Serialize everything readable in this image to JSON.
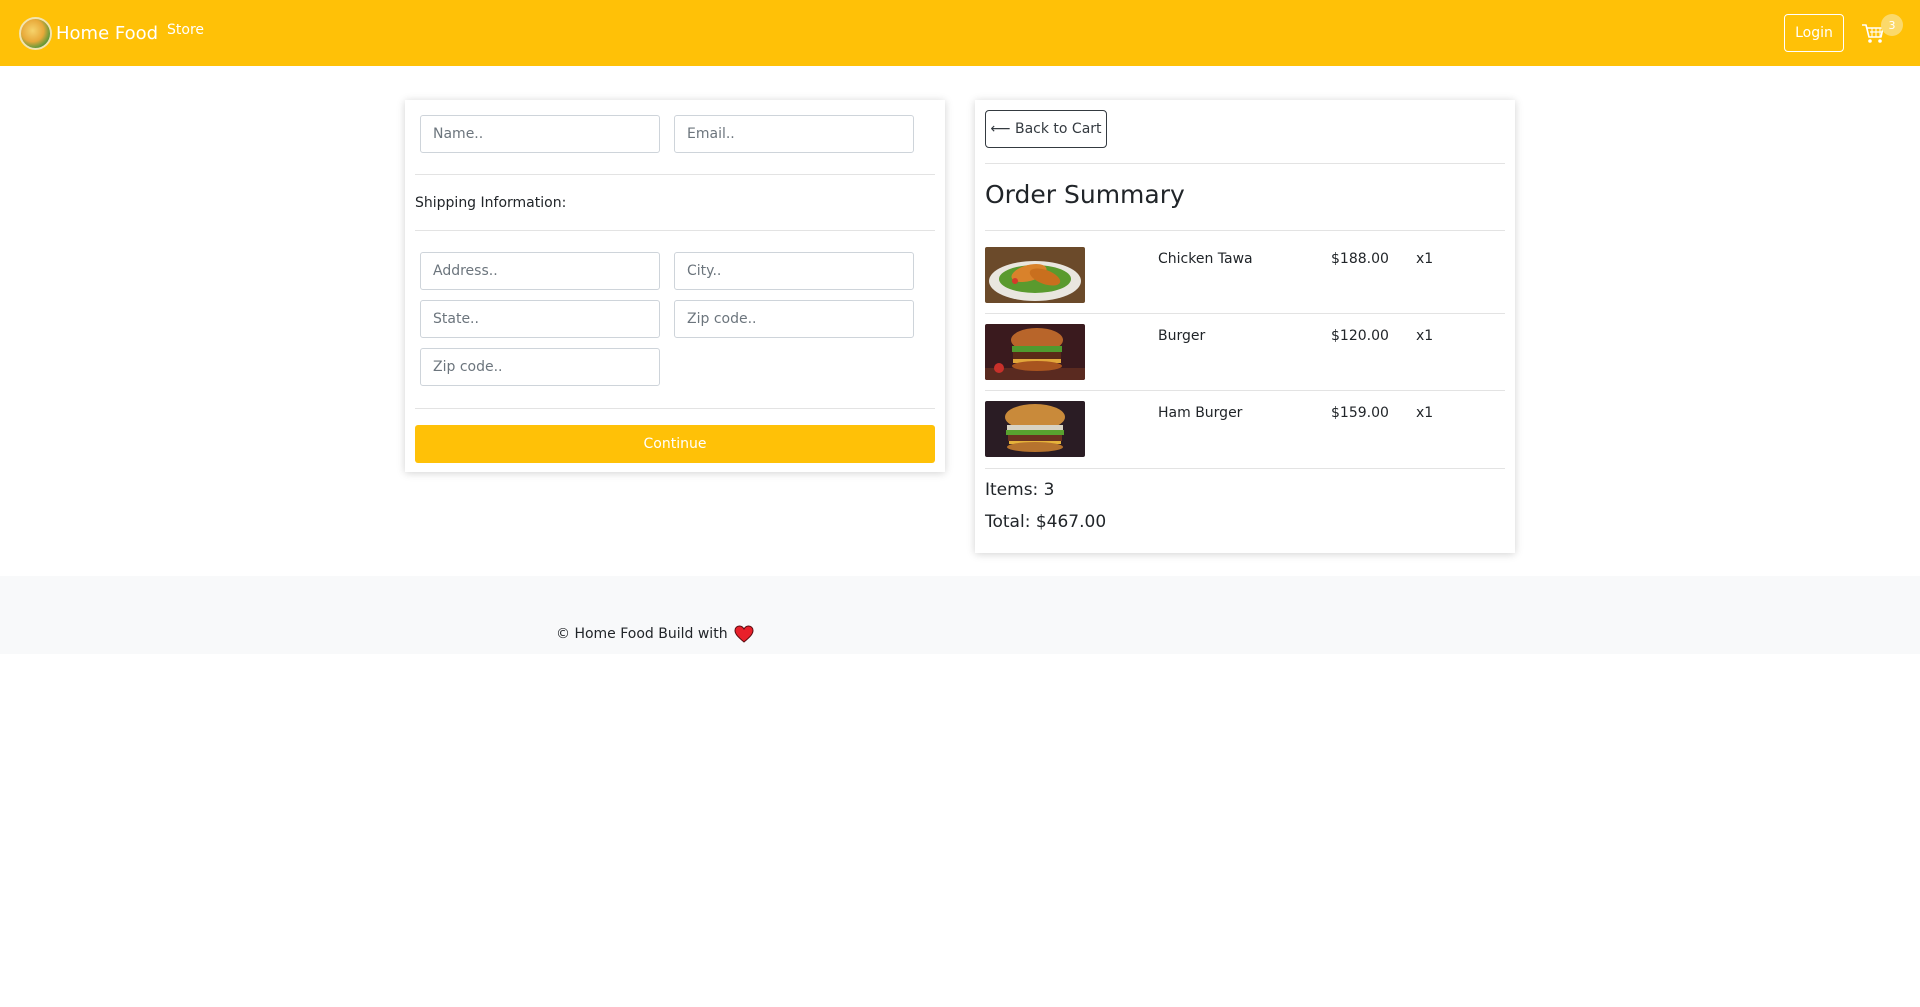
{
  "navbar": {
    "brand": "Home Food",
    "store": "Store",
    "login": "Login",
    "cart_count": "3",
    "color": "#ffc107"
  },
  "form": {
    "name_placeholder": "Name..",
    "email_placeholder": "Email..",
    "shipping_label": "Shipping Information:",
    "address_placeholder": "Address..",
    "city_placeholder": "City..",
    "state_placeholder": "State..",
    "zip_placeholder": "Zip code..",
    "zip2_placeholder": "Zip code..",
    "continue": "Continue"
  },
  "summary": {
    "back": "⟵ Back to Cart",
    "title": "Order Summary",
    "items": [
      {
        "name": "Chicken Tawa",
        "price": "$188.00",
        "qty": "x1",
        "image": "chicken-tawa-photo"
      },
      {
        "name": "Burger",
        "price": "$120.00",
        "qty": "x1",
        "image": "burger-photo"
      },
      {
        "name": "Ham Burger",
        "price": "$159.00",
        "qty": "x1",
        "image": "ham-burger-photo"
      }
    ],
    "items_count": "Items: 3",
    "total": "Total: $467.00"
  },
  "footer": {
    "text": "© Home Food Build with",
    "icon": "heart-icon"
  }
}
